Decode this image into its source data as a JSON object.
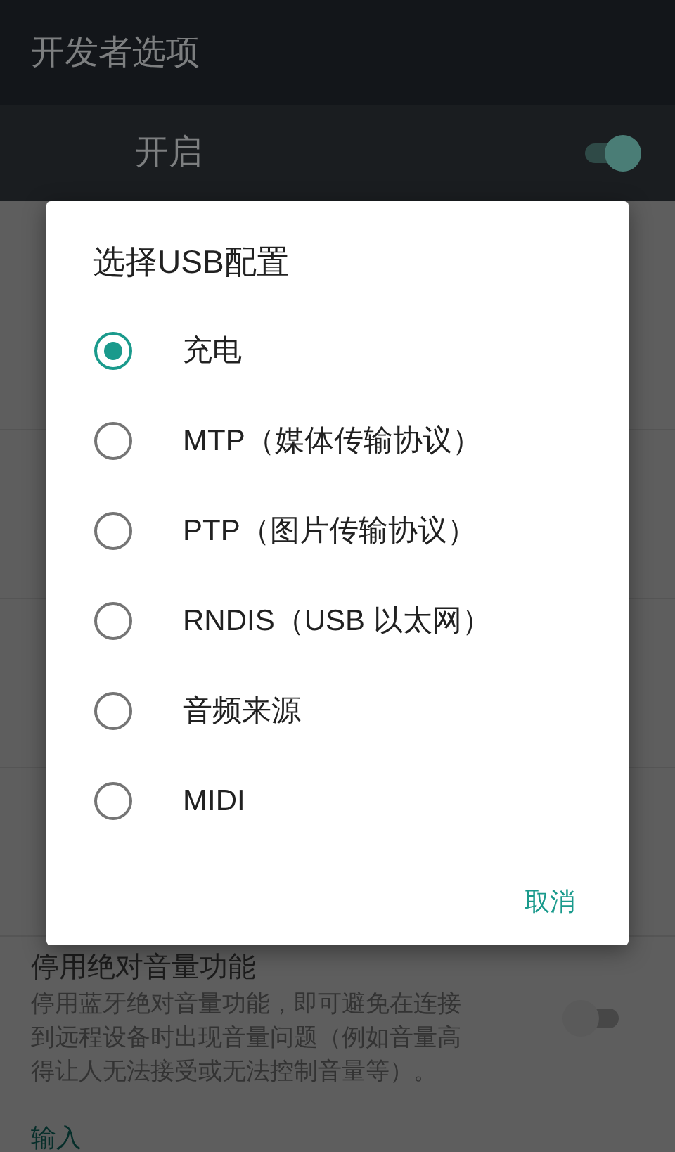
{
  "app_bar": {
    "title": "开发者选项"
  },
  "master_switch": {
    "label": "开启",
    "on": true
  },
  "bottom_setting": {
    "title": "停用绝对音量功能",
    "description": "停用蓝牙绝对音量功能，即可避免在连接到远程设备时出现音量问题（例如音量高得让人无法接受或无法控制音量等）。",
    "on": false
  },
  "next_section": {
    "title": "输入"
  },
  "dialog": {
    "title": "选择USB配置",
    "options": [
      {
        "label": "充电",
        "selected": true
      },
      {
        "label": "MTP（媒体传输协议）",
        "selected": false
      },
      {
        "label": "PTP（图片传输协议）",
        "selected": false
      },
      {
        "label": "RNDIS（USB 以太网）",
        "selected": false
      },
      {
        "label": "音频来源",
        "selected": false
      },
      {
        "label": "MIDI",
        "selected": false
      }
    ],
    "cancel": "取消"
  }
}
